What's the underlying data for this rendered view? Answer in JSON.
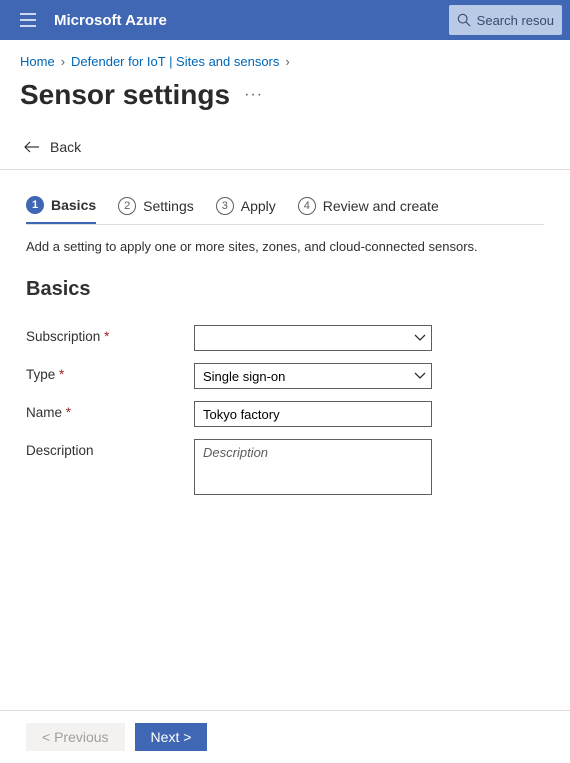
{
  "topbar": {
    "brand": "Microsoft Azure",
    "search_placeholder": "Search resou"
  },
  "breadcrumb": {
    "items": [
      {
        "label": "Home"
      },
      {
        "label": "Defender for IoT | Sites and sensors"
      }
    ]
  },
  "page": {
    "title": "Sensor settings",
    "back_label": "Back"
  },
  "tabs": [
    {
      "num": "1",
      "label": "Basics",
      "active": true
    },
    {
      "num": "2",
      "label": "Settings",
      "active": false
    },
    {
      "num": "3",
      "label": "Apply",
      "active": false
    },
    {
      "num": "4",
      "label": "Review and create",
      "active": false
    }
  ],
  "helper_text": "Add a setting to apply one or more sites, zones, and cloud-connected sensors.",
  "section_heading": "Basics",
  "form": {
    "subscription": {
      "label": "Subscription",
      "required": true,
      "value": ""
    },
    "type": {
      "label": "Type",
      "required": true,
      "value": "Single sign-on"
    },
    "name": {
      "label": "Name",
      "required": true,
      "value": "Tokyo factory"
    },
    "description": {
      "label": "Description",
      "required": false,
      "placeholder": "Description",
      "value": ""
    }
  },
  "footer": {
    "previous": "< Previous",
    "next": "Next >"
  },
  "colors": {
    "accent": "#4067b3",
    "link": "#0067b8",
    "required": "#a4262c"
  }
}
